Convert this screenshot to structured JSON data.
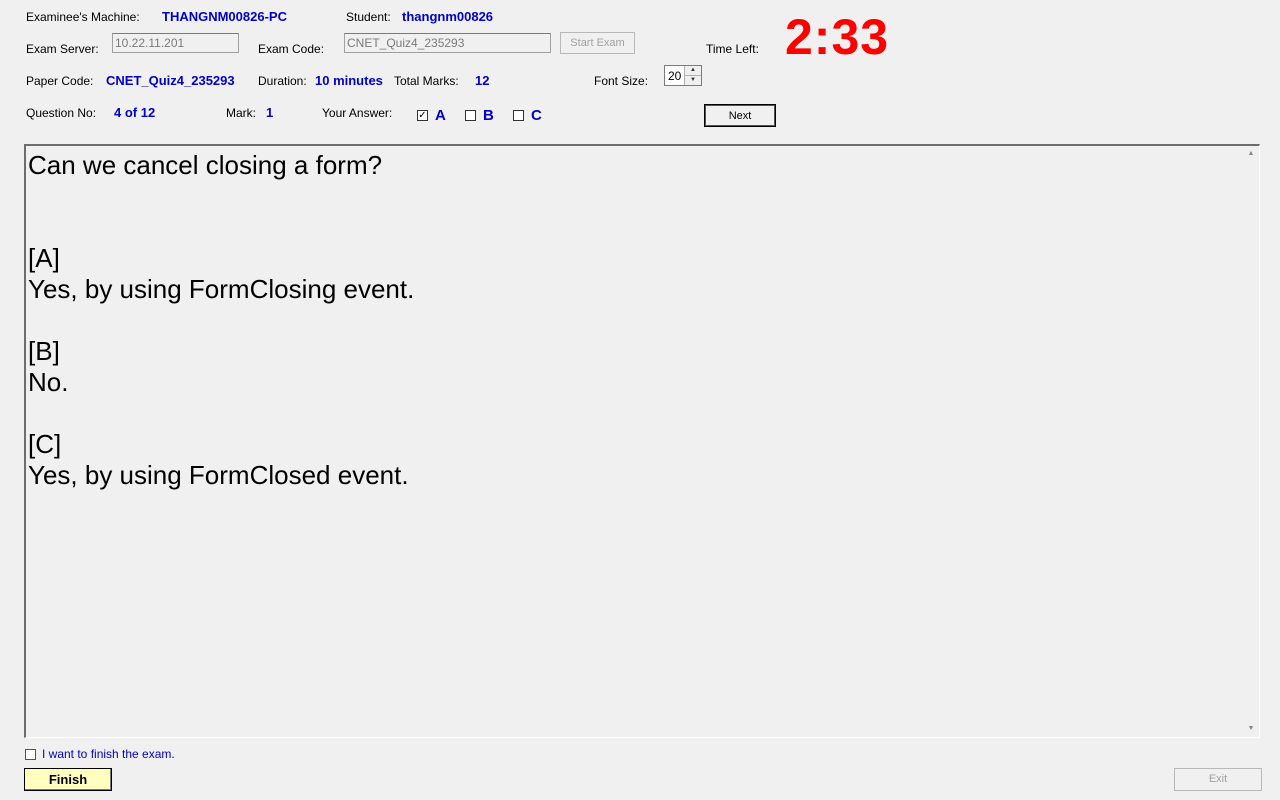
{
  "header": {
    "machine_label": "Examinee's Machine:",
    "machine_value": "THANGNM00826-PC",
    "student_label": "Student:",
    "student_value": "thangnm00826",
    "server_label": "Exam Server:",
    "server_value": "10.22.11.201",
    "exam_code_label": "Exam Code:",
    "exam_code_value": "CNET_Quiz4_235293",
    "start_exam_label": "Start Exam",
    "time_left_label": "Time Left:",
    "time_left_value": "2:33",
    "paper_code_label": "Paper Code:",
    "paper_code_value": "CNET_Quiz4_235293",
    "duration_label": "Duration:",
    "duration_value": "10 minutes",
    "total_marks_label": "Total Marks:",
    "total_marks_value": "12",
    "font_size_label": "Font Size:",
    "font_size_value": "20",
    "question_no_label": "Question No:",
    "question_no_value": "4 of 12",
    "mark_label": "Mark:",
    "mark_value": "1",
    "your_answer_label": "Your Answer:",
    "next_label": "Next"
  },
  "answers": [
    {
      "letter": "A",
      "checked": true
    },
    {
      "letter": "B",
      "checked": false
    },
    {
      "letter": "C",
      "checked": false
    }
  ],
  "question": {
    "text": "Can we cancel closing a form?\n\n\n[A]\nYes, by using FormClosing event.\n\n[B]\nNo.\n\n[C]\nYes, by using FormClosed event."
  },
  "footer": {
    "finish_checkbox_label": "I want to finish the exam.",
    "finish_label": "Finish",
    "exit_label": "Exit"
  },
  "colors": {
    "value_blue": "#0000cc",
    "timer_red": "#ff0000",
    "finish_bg": "#ffffc0"
  }
}
